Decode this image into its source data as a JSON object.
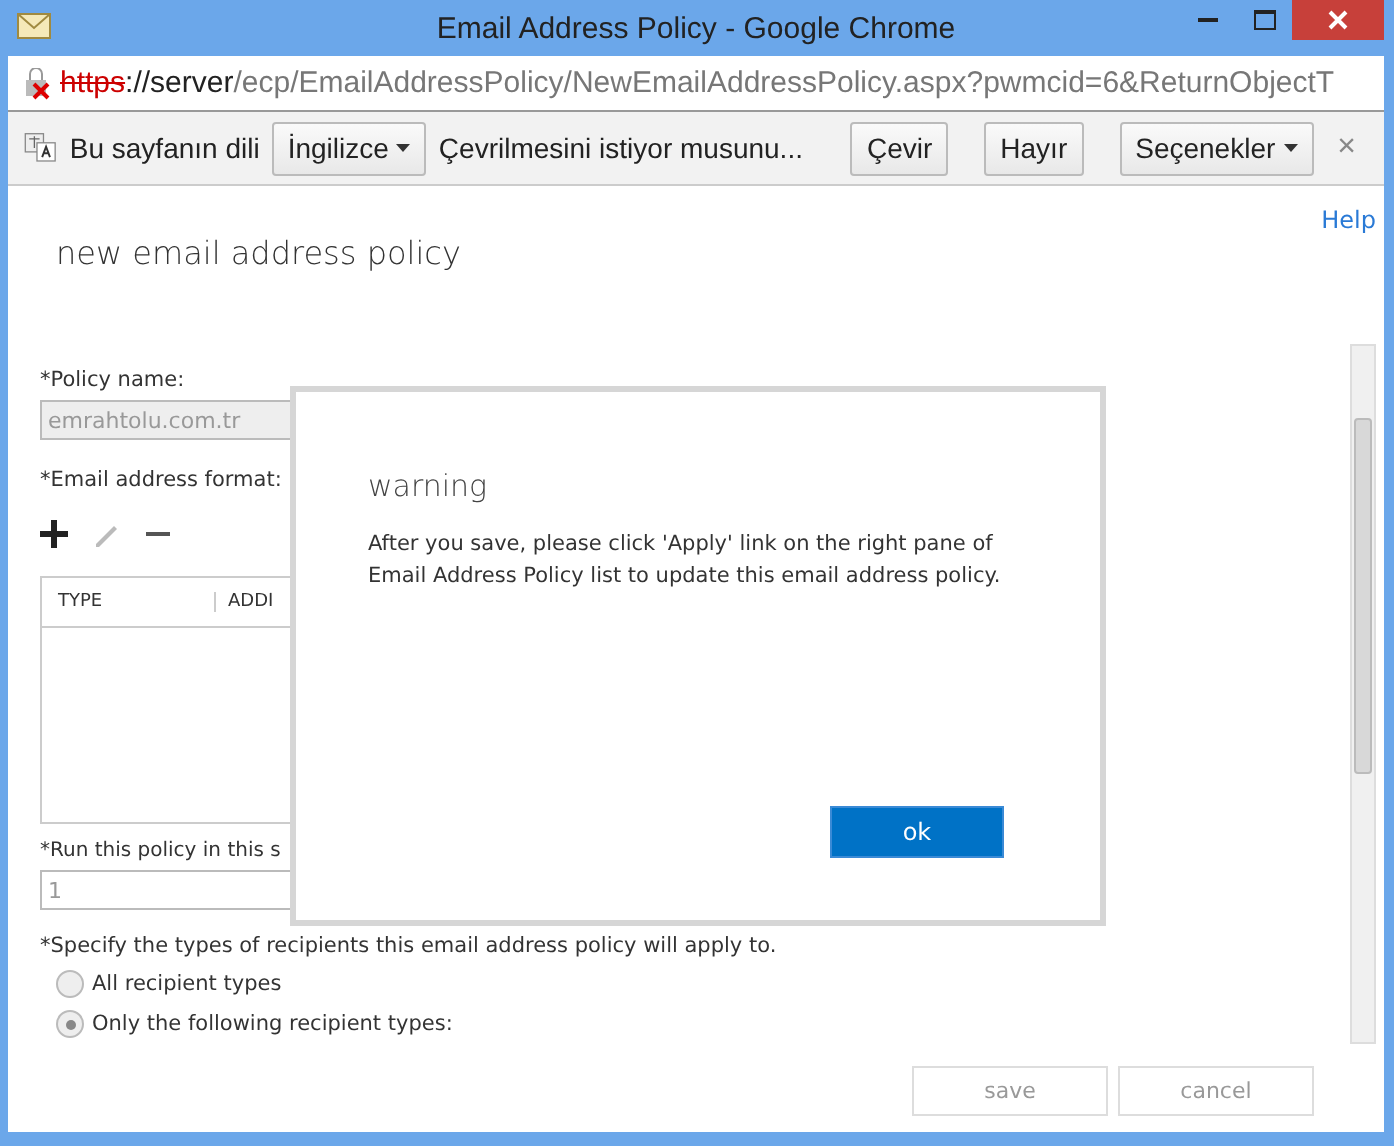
{
  "window": {
    "title": "Email Address Policy - Google Chrome"
  },
  "address_bar": {
    "scheme": "https",
    "rest_host": "://server",
    "path": "/ecp/EmailAddressPolicy/NewEmailAddressPolicy.aspx?pwmcid=6&ReturnObjectT"
  },
  "translate_bar": {
    "label": "Bu sayfanın dili",
    "language": "İngilizce",
    "question": "Çevrilmesini istiyor musunu...",
    "buttons": [
      "Çevir",
      "Hayır"
    ],
    "options": "Seçenekler",
    "close": "×"
  },
  "help_link": "Help",
  "page_title": "new email address policy",
  "policy_name": {
    "label": "*Policy name:",
    "value": "emrahtolu.com.tr"
  },
  "email_format": {
    "label": "*Email address format:",
    "columns": [
      "TYPE",
      "ADDI"
    ]
  },
  "run_order": {
    "label": "*Run this policy in this s",
    "value": "1"
  },
  "recipients": {
    "label": "*Specify the types of recipients this email address policy will apply to.",
    "options": [
      {
        "label": "All recipient types",
        "selected": false
      },
      {
        "label": "Only the following recipient types:",
        "selected": true
      }
    ]
  },
  "footer_buttons": [
    "save",
    "cancel"
  ],
  "dialog": {
    "title": "warning",
    "message": "After you save, please click 'Apply' link on the right pane of Email Address Policy list to update this email address policy.",
    "button": "ok"
  }
}
